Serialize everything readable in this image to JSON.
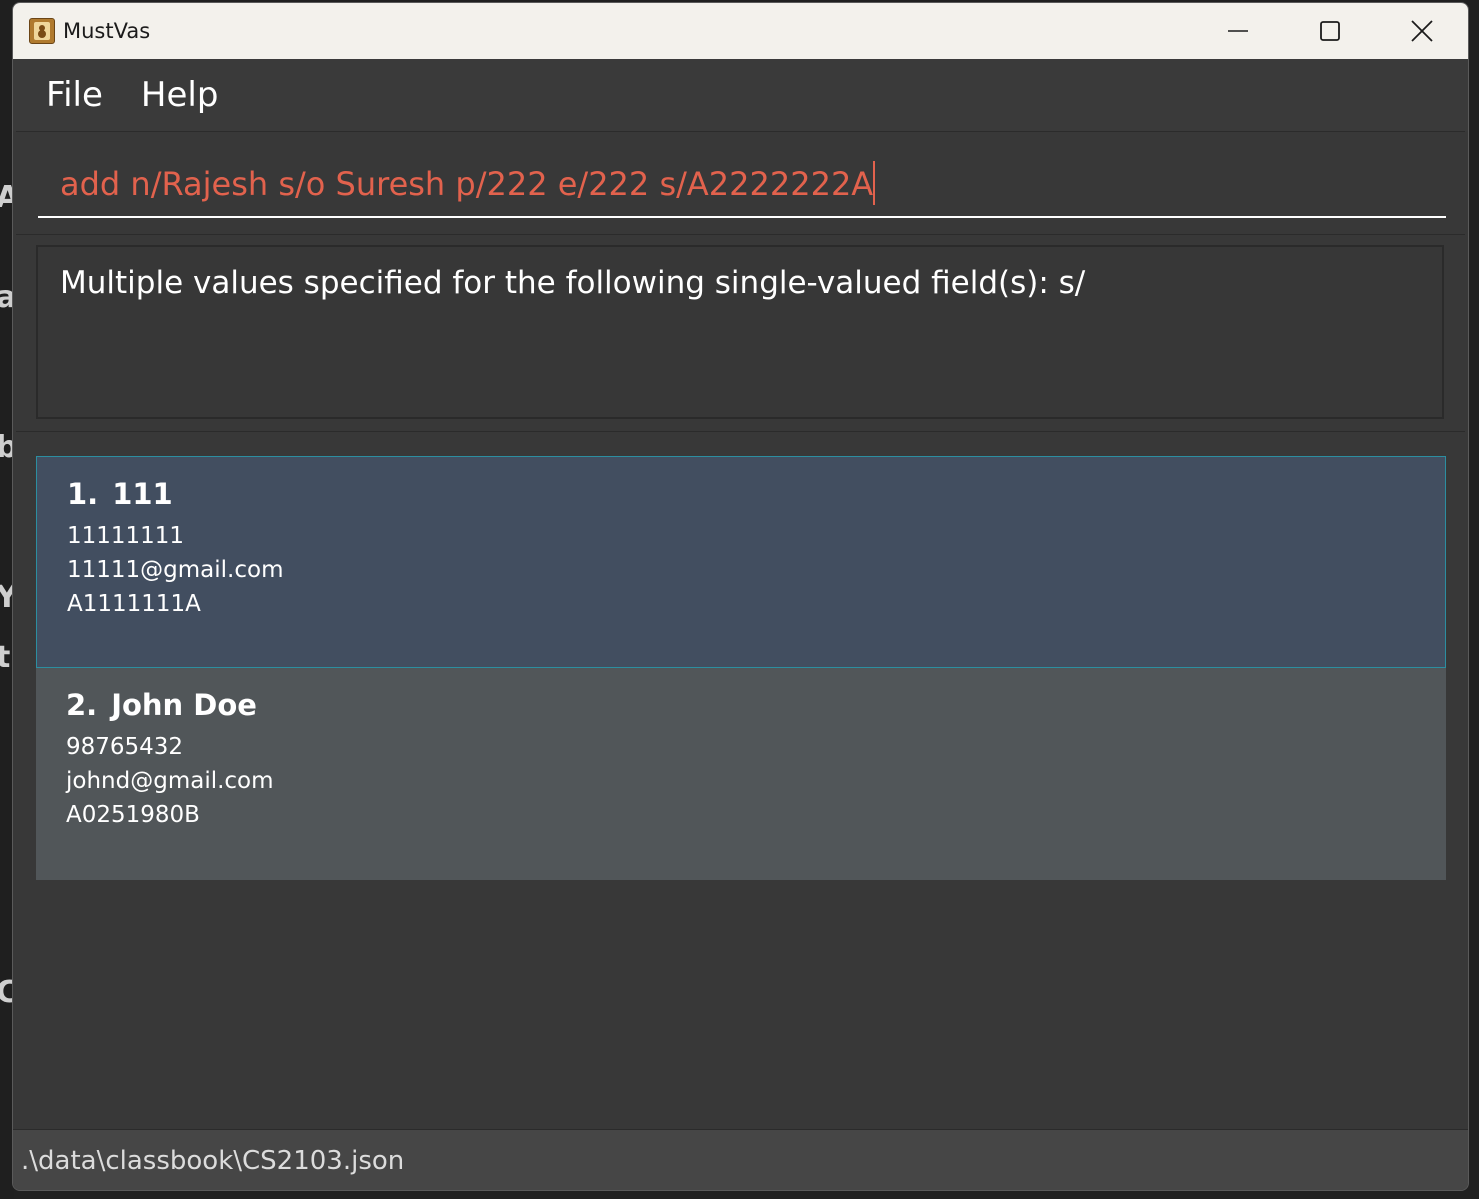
{
  "window": {
    "title": "MustVas"
  },
  "menu": {
    "items": [
      "File",
      "Help"
    ]
  },
  "command": {
    "value": "add n/Rajesh s/o Suresh p/222 e/222 s/A2222222A"
  },
  "result": {
    "message": "Multiple values specified for the following single-valued field(s): s/"
  },
  "persons": [
    {
      "index": "1.",
      "name": "111",
      "phone": "11111111",
      "email": "11111@gmail.com",
      "student_id": "A1111111A",
      "selected": true
    },
    {
      "index": "2.",
      "name": "John Doe",
      "phone": "98765432",
      "email": "johnd@gmail.com",
      "student_id": "A0251980B",
      "selected": false
    }
  ],
  "status": {
    "file_path": ".\\data\\classbook\\CS2103.json"
  },
  "colors": {
    "command_text": "#e2624d",
    "selected_card": "#424e60",
    "card": "#515659",
    "selected_border": "#2c8ea0"
  },
  "icons": {
    "app": "address-book-icon",
    "minimize": "minimize-icon",
    "maximize": "maximize-icon",
    "close": "close-icon"
  }
}
